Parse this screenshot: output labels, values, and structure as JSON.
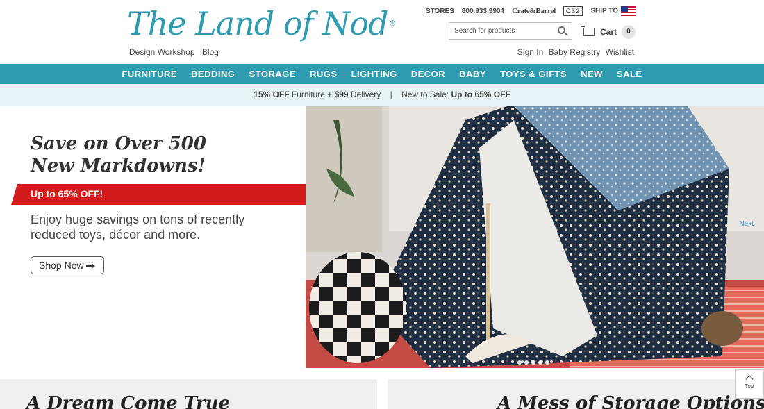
{
  "brand": {
    "logo_text": "The Land of Nod",
    "logo_mark": "®"
  },
  "header": {
    "sublinks": [
      "Design Workshop",
      "Blog"
    ],
    "utility": {
      "stores": "STORES",
      "phone": "800.933.9904",
      "crate_barrel": "Crate&Barrel",
      "cb2": "CB2",
      "ship_to": "SHIP TO"
    },
    "search": {
      "placeholder": "Search for products"
    },
    "cart": {
      "label": "Cart",
      "count": "0"
    },
    "account": [
      "Sign In",
      "Baby Registry",
      "Wishlist"
    ]
  },
  "nav": [
    "FURNITURE",
    "BEDDING",
    "STORAGE",
    "RUGS",
    "LIGHTING",
    "DECOR",
    "BABY",
    "TOYS & GIFTS",
    "NEW",
    "SALE"
  ],
  "promo": {
    "left_bold": "15% OFF",
    "left_mid": " Furniture + ",
    "left_bold2": "$99",
    "left_tail": " Delivery",
    "sep": "|",
    "right_text": "New to Sale: ",
    "right_bold": "Up to 65% OFF"
  },
  "hero": {
    "headline": "Save on Over 500 New Markdowns!",
    "ribbon": "Up to 65% OFF!",
    "description": "Enjoy huge savings on tons of recently reduced toys, décor and more.",
    "cta": "Shop Now",
    "next": "Next",
    "slide_count": 5
  },
  "tiles": {
    "left_title": "A Dream Come True",
    "right_title": "A Mess of Storage Options"
  },
  "back_to_top": "Top",
  "colors": {
    "brand_teal": "#2f9bb1",
    "promo_bg": "#e8f3f7",
    "ribbon_red": "#d31b1b",
    "link_blue": "#3a8fc2"
  }
}
